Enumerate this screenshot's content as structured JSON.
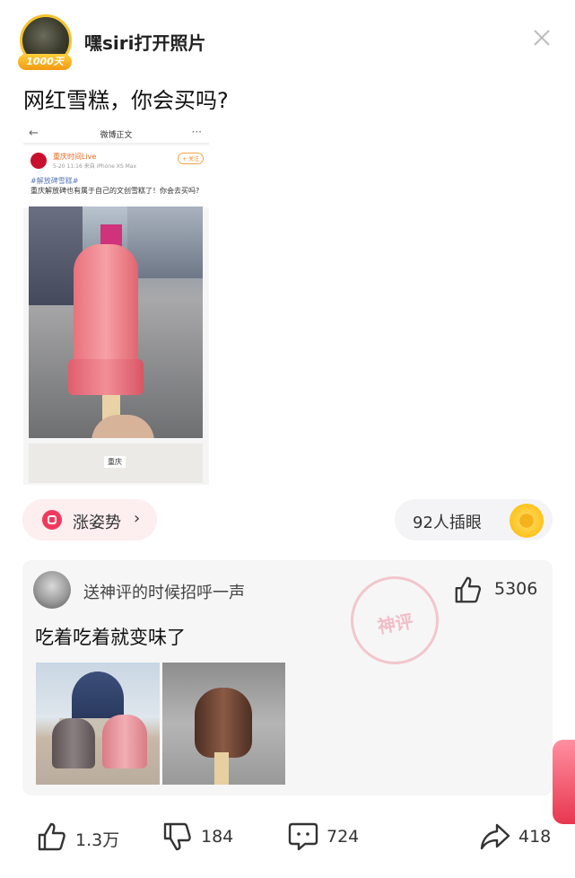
{
  "header": {
    "username": "嘿siri打开照片",
    "avatar_badge": "1000天"
  },
  "post": {
    "title": "网红雪糕，你会买吗?"
  },
  "embedded_screenshot": {
    "nav_title": "微博正文",
    "author": "重庆时间Live",
    "meta": "5-20 11:16  来自 iPhone XS Max",
    "follow_label": "+ 关注",
    "hashtag": "#解放碑雪糕#",
    "text": "重庆解放碑也有属于自己的文创雪糕了！你会去买吗?",
    "map_label": "重庆"
  },
  "trend_button": {
    "label": "涨姿势",
    "chevron": "›"
  },
  "peek_button": {
    "label": "92人插眼"
  },
  "hot_comment": {
    "username": "送神评的时候招呼一声",
    "like_count": "5306",
    "stamp_text": "神评",
    "text": "吃着吃着就变味了"
  },
  "actions": {
    "like_count": "1.3万",
    "dislike_count": "184",
    "comment_count": "724",
    "share_count": "418"
  },
  "colors": {
    "accent_red": "#f03a5d",
    "badge_gold": "#f4c430"
  }
}
